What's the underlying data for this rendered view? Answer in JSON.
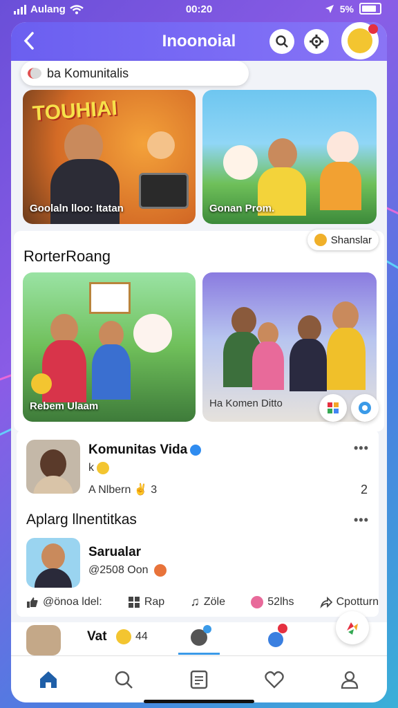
{
  "status": {
    "carrier": "Aulang",
    "time": "00:20",
    "battery": "5%"
  },
  "header": {
    "title": "Inoonoial",
    "back_icon": "chevron-left-icon"
  },
  "search": {
    "text": "ba Komunitalis"
  },
  "cards_top": [
    {
      "caption": "Goolaln lloo: Itatan",
      "banner": "TOUHIAI"
    },
    {
      "caption": "Gonan Prom."
    }
  ],
  "section": {
    "title": "RorterRoang",
    "chip_label": "Shanslar"
  },
  "cards_mid": [
    {
      "caption": "Rebem Ulaam"
    },
    {
      "caption": "Ha Komen Ditto"
    }
  ],
  "post1": {
    "name": "Komunitas Vida",
    "line2": "k",
    "meta": "A Nlbern",
    "meta_count": "3",
    "count": "2",
    "more": "•••"
  },
  "post2": {
    "section_title": "Aplarg llnentitkas",
    "name": "Sarualar",
    "meta": "@2508 Oon",
    "more": "•••"
  },
  "actions": [
    {
      "icon": "thumbs-up-icon",
      "label": "@önoa ldel:"
    },
    {
      "icon": "grid-icon",
      "label": "Rap"
    },
    {
      "icon": "music-note-icon",
      "label": "Zöle"
    },
    {
      "icon": "emoji-icon",
      "label": "52lhs"
    },
    {
      "icon": "share-icon",
      "label": "Cpotturn"
    }
  ],
  "bottom_preview": {
    "name": "Vat",
    "count": "44"
  },
  "tabs": [
    "home-icon",
    "search-icon",
    "feed-icon",
    "heart-icon",
    "profile-icon"
  ],
  "colors": {
    "accent": "#6b5ff0",
    "home_active": "#1f5fa8"
  }
}
